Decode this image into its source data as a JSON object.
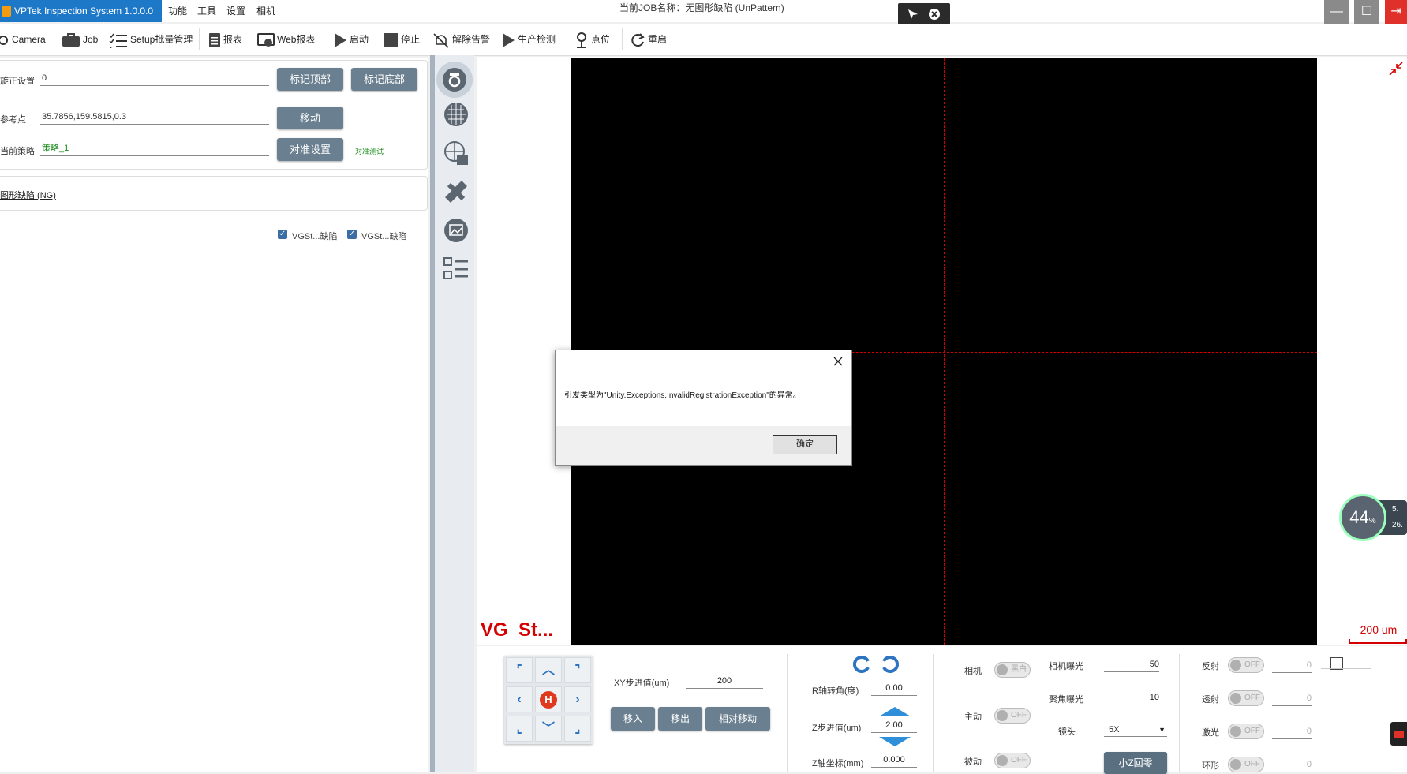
{
  "app": {
    "title": "VPTek Inspection System 1.0.0.0",
    "job_label": "当前JOB名称：无图形缺陷 (UnPattern)"
  },
  "menu": [
    "功能",
    "工具",
    "设置",
    "相机"
  ],
  "toolbar": [
    {
      "label": "Camera",
      "icon": "camera-icon"
    },
    {
      "label": "Job",
      "icon": "briefcase-icon"
    },
    {
      "label": "Setup批量管理",
      "icon": "checklist-icon"
    },
    {
      "label": "报表",
      "icon": "report-icon"
    },
    {
      "label": "Web报表",
      "icon": "web-report-icon"
    },
    {
      "label": "启动",
      "icon": "play-icon"
    },
    {
      "label": "停止",
      "icon": "stop-icon"
    },
    {
      "label": "解除告警",
      "icon": "bell-off-icon"
    },
    {
      "label": "生产检测",
      "icon": "play-icon"
    },
    {
      "label": "点位",
      "icon": "location-icon"
    },
    {
      "label": "重启",
      "icon": "refresh-icon"
    }
  ],
  "left": {
    "row1": {
      "label": "旋正设置",
      "value": "0",
      "btn1": "标记顶部",
      "btn2": "标记底部"
    },
    "row2": {
      "label": "参考点",
      "value": "35.7856,159.5815,0.3",
      "btn": "移动"
    },
    "row3": {
      "label": "当前策略",
      "value": "策略_1",
      "btn": "对准设置",
      "link": "对准测试"
    },
    "defect_link": "图形缺陷 (NG)",
    "checks": [
      "VGSt...缺陷",
      "VGSt...缺陷"
    ]
  },
  "viewer": {
    "label": "VG_St...",
    "scale": "200 um"
  },
  "dialog": {
    "message": "引发类型为\"Unity.Exceptions.InvalidRegistrationException\"的异常。",
    "ok": "确定"
  },
  "controls": {
    "xy_step_label": "XY步进值(um)",
    "xy_step": "200",
    "move_in": "移入",
    "move_out": "移出",
    "relative_move": "相对移动",
    "r_angle_label": "R轴转角(度)",
    "r_angle": "0.00",
    "z_step_label": "Z步进值(um)",
    "z_step": "2.00",
    "z_coord_label": "Z轴坐标(mm)",
    "z_coord": "0.000",
    "camera_label": "相机",
    "camera_toggle": "黑白",
    "active_label": "主动",
    "passive_label": "被动",
    "off": "OFF",
    "cam_exposure_label": "相机曝光",
    "cam_exposure": "50",
    "focus_exposure_label": "聚焦曝光",
    "focus_exposure": "10",
    "lens_label": "镜头",
    "lens": "5X",
    "z_home": "小Z回零",
    "lights": [
      {
        "label": "反射",
        "value": "0"
      },
      {
        "label": "透射",
        "value": "0"
      },
      {
        "label": "激光",
        "value": "0"
      },
      {
        "label": "环形",
        "value": "0"
      }
    ],
    "jog_home": "H"
  },
  "speed": {
    "percent": "44",
    "unit": "%",
    "up": "5.",
    "down": "26."
  },
  "colors": {
    "accent": "#1e78c8",
    "crosshair": "#d40000",
    "button": "#6a7f8f"
  }
}
